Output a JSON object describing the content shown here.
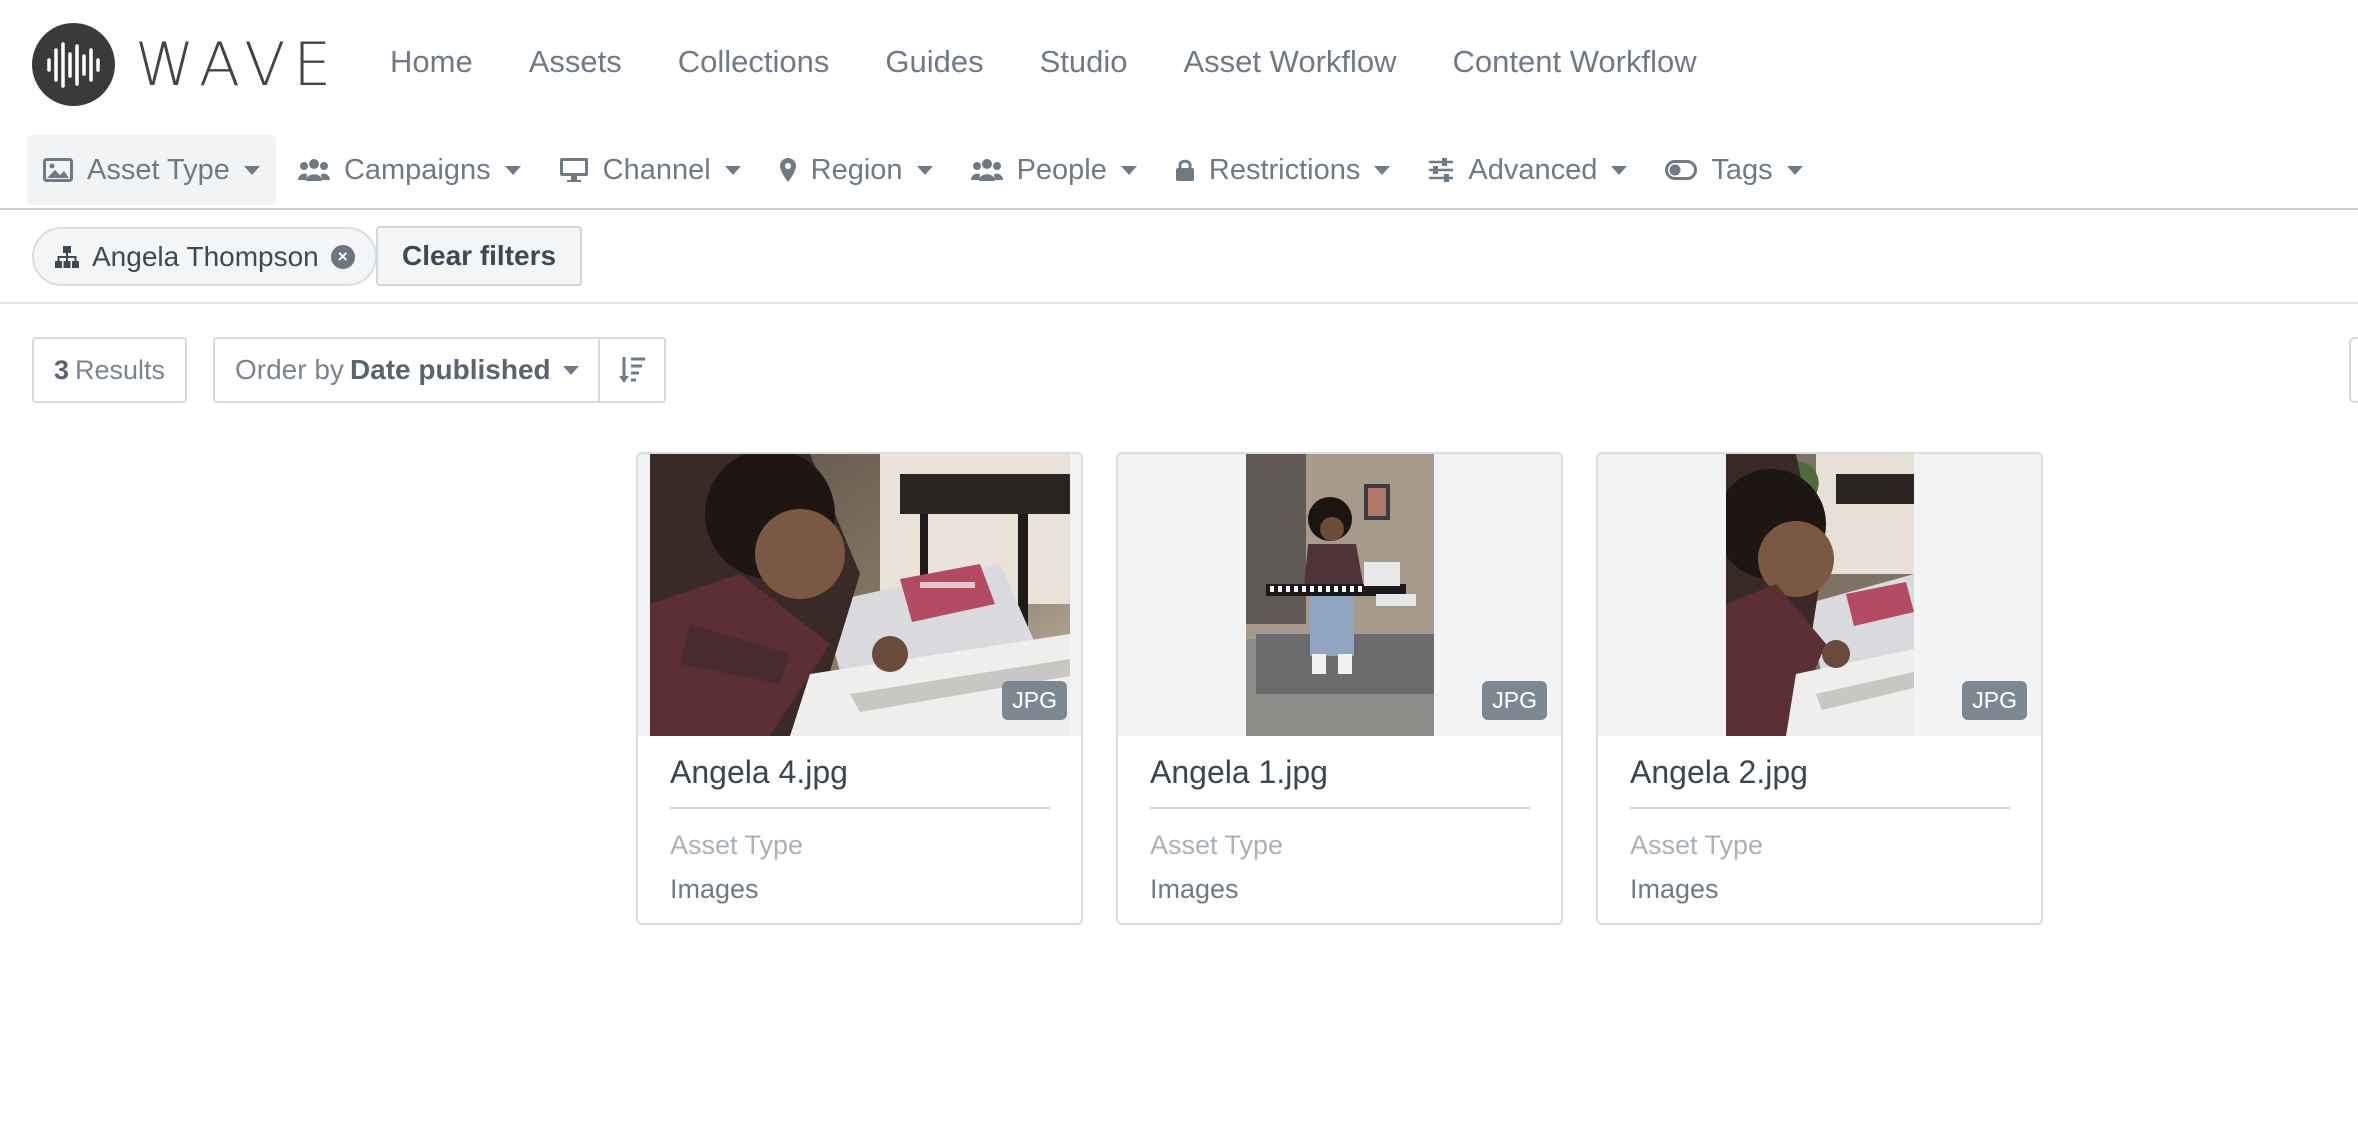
{
  "brand": {
    "name": "WAVE"
  },
  "nav": {
    "items": [
      "Home",
      "Assets",
      "Collections",
      "Guides",
      "Studio",
      "Asset Workflow",
      "Content Workflow"
    ]
  },
  "filters": [
    {
      "label": "Asset Type",
      "icon": "image-icon"
    },
    {
      "label": "Campaigns",
      "icon": "users-icon"
    },
    {
      "label": "Channel",
      "icon": "monitor-icon"
    },
    {
      "label": "Region",
      "icon": "map-marker-icon"
    },
    {
      "label": "People",
      "icon": "users-icon"
    },
    {
      "label": "Restrictions",
      "icon": "lock-icon"
    },
    {
      "label": "Advanced",
      "icon": "sliders-icon"
    },
    {
      "label": "Tags",
      "icon": "toggle-icon"
    }
  ],
  "active_filters": {
    "chip_label": "Angela Thompson",
    "chip_icon": "sitemap-icon",
    "clear_label": "Clear filters"
  },
  "results": {
    "count": "3",
    "count_label": "Results",
    "order_prefix": "Order by",
    "order_value": "Date published"
  },
  "cards": [
    {
      "title": "Angela 4.jpg",
      "badge": "JPG",
      "meta_label": "Asset Type",
      "meta_value": "Images"
    },
    {
      "title": "Angela 1.jpg",
      "badge": "JPG",
      "meta_label": "Asset Type",
      "meta_value": "Images"
    },
    {
      "title": "Angela 2.jpg",
      "badge": "JPG",
      "meta_label": "Asset Type",
      "meta_value": "Images"
    }
  ],
  "colors": {
    "text": "#6b7682",
    "logo": "#3a3a3a",
    "border": "#d9dde1",
    "badge": "#7d8791"
  }
}
